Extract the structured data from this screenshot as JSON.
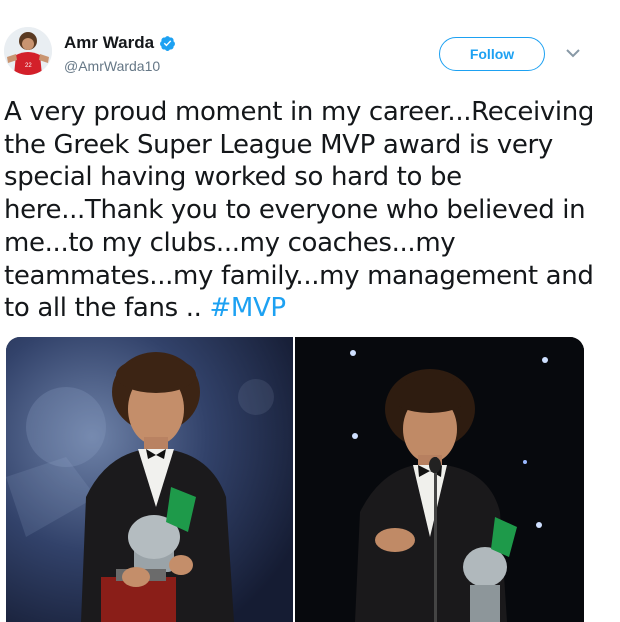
{
  "tweet": {
    "author": {
      "display_name": "Amr Warda",
      "handle": "@AmrWarda10",
      "verified": true,
      "avatar_icon": "player-avatar-icon"
    },
    "follow_label": "Follow",
    "caret_icon": "chevron-down-icon",
    "text_lines": [
      "A very proud moment in my career...Receiving",
      "the Greek Super League MVP award is very",
      "special having worked so hard to be",
      "here...Thank you to everyone who believed in",
      "me...to my clubs...my coaches...my",
      "teammates...my family...my management and",
      "to all the fans .. "
    ],
    "hashtag": "#MVP",
    "media": [
      {
        "icon": "photo-trophy-left"
      },
      {
        "icon": "photo-trophy-right"
      }
    ]
  },
  "colors": {
    "accent": "#1da1f2",
    "text": "#14171a",
    "muted": "#657786"
  }
}
